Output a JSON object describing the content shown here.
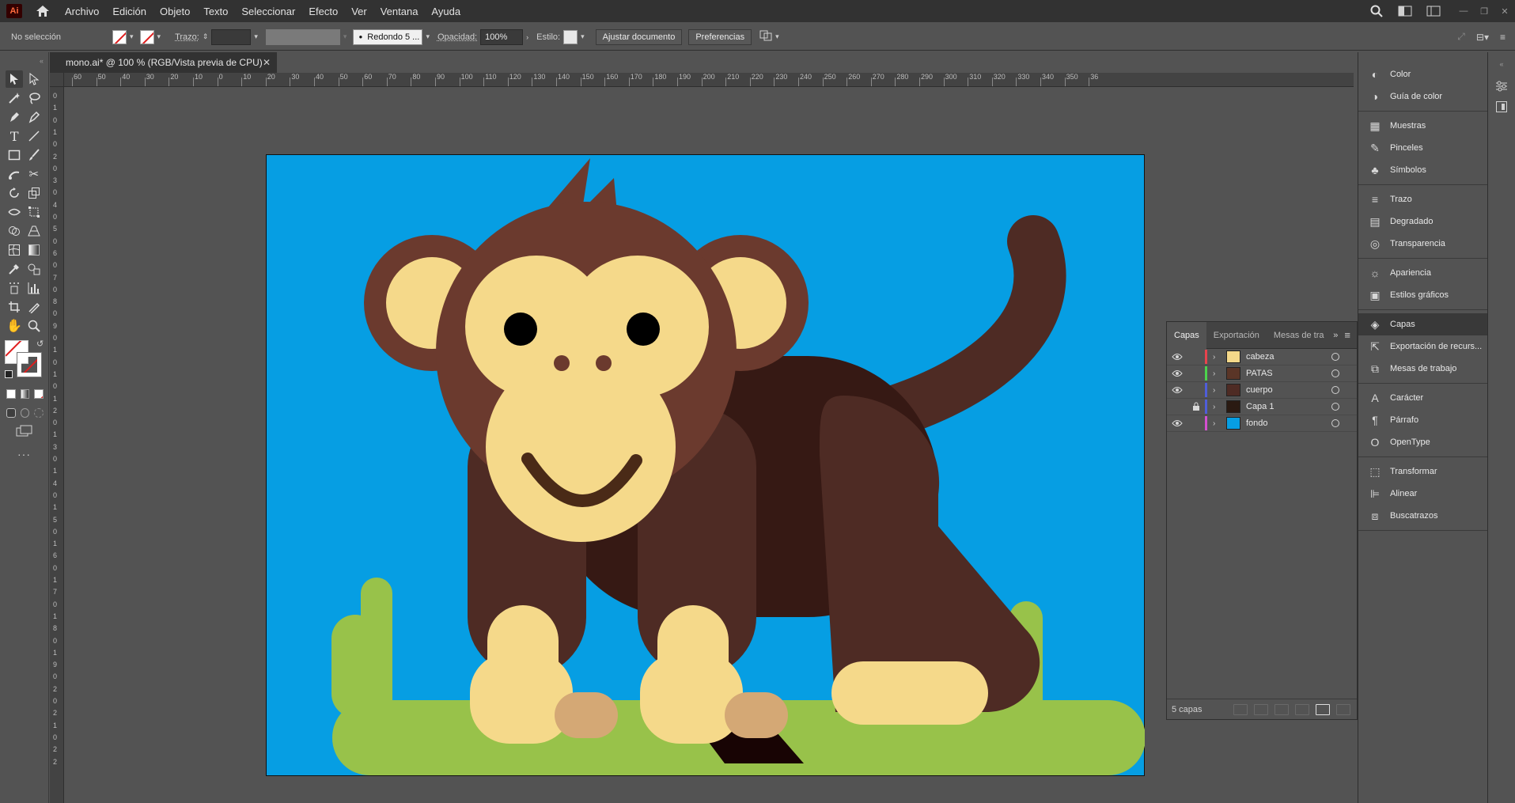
{
  "menubar": {
    "app_logo": "Ai",
    "items": [
      "Archivo",
      "Edición",
      "Objeto",
      "Texto",
      "Seleccionar",
      "Efecto",
      "Ver",
      "Ventana",
      "Ayuda"
    ]
  },
  "controlbar": {
    "selection": "No selección",
    "stroke_label": "Trazo:",
    "brush": "Redondo 5 ...",
    "opacity_label": "Opacidad:",
    "opacity_value": "100%",
    "style_label": "Estilo:",
    "fit_button": "Ajustar documento",
    "prefs_button": "Preferencias"
  },
  "document": {
    "tab_title": "mono.ai* @ 100 % (RGB/Vista previa de CPU)",
    "ruler_h": [
      "60",
      "50",
      "40",
      "30",
      "20",
      "10",
      "0",
      "10",
      "20",
      "30",
      "40",
      "50",
      "60",
      "70",
      "80",
      "90",
      "100",
      "110",
      "120",
      "130",
      "140",
      "150",
      "160",
      "170",
      "180",
      "190",
      "200",
      "210",
      "220",
      "230",
      "240",
      "250",
      "260",
      "270",
      "280",
      "290",
      "300",
      "310",
      "320",
      "330",
      "340",
      "350",
      "36"
    ],
    "ruler_v": [
      "0",
      "1",
      "0",
      "1",
      "0",
      "2",
      "0",
      "3",
      "0",
      "4",
      "0",
      "5",
      "0",
      "6",
      "0",
      "7",
      "0",
      "8",
      "0",
      "9",
      "0",
      "1",
      "0",
      "1",
      "0",
      "1",
      "2",
      "0",
      "1",
      "3",
      "0",
      "1",
      "4",
      "0",
      "1",
      "5",
      "0",
      "1",
      "6",
      "0",
      "1",
      "7",
      "0",
      "1",
      "8",
      "0",
      "1",
      "9",
      "0",
      "2",
      "0",
      "2",
      "1",
      "0",
      "2",
      "2"
    ]
  },
  "layers_panel": {
    "tabs": [
      "Capas",
      "Exportación",
      "Mesas de tra"
    ],
    "layers": [
      {
        "name": "cabeza",
        "color": "#e8434d",
        "thumb": "#f5d98a",
        "visible": true,
        "locked": false
      },
      {
        "name": "PATAS",
        "color": "#4cd34c",
        "thumb": "#5a3527",
        "visible": true,
        "locked": false
      },
      {
        "name": "cuerpo",
        "color": "#4f5ed9",
        "thumb": "#4e2b24",
        "visible": true,
        "locked": false
      },
      {
        "name": "Capa 1",
        "color": "#4f5ed9",
        "thumb": "#2a1a12",
        "visible": false,
        "locked": true
      },
      {
        "name": "fondo",
        "color": "#d44fd0",
        "thumb": "#069ee3",
        "visible": true,
        "locked": false
      }
    ],
    "count": "5 capas"
  },
  "right_dock": {
    "groups": [
      [
        {
          "label": "Color",
          "icon": "color-icon"
        },
        {
          "label": "Guía de color",
          "icon": "color-guide-icon"
        }
      ],
      [
        {
          "label": "Muestras",
          "icon": "swatches-icon"
        },
        {
          "label": "Pinceles",
          "icon": "brushes-icon"
        },
        {
          "label": "Símbolos",
          "icon": "symbols-icon"
        }
      ],
      [
        {
          "label": "Trazo",
          "icon": "stroke-icon"
        },
        {
          "label": "Degradado",
          "icon": "gradient-icon"
        },
        {
          "label": "Transparencia",
          "icon": "transparency-icon"
        }
      ],
      [
        {
          "label": "Apariencia",
          "icon": "appearance-icon"
        },
        {
          "label": "Estilos gráficos",
          "icon": "graphic-styles-icon"
        }
      ],
      [
        {
          "label": "Capas",
          "icon": "layers-icon",
          "active": true
        },
        {
          "label": "Exportación de recurs...",
          "icon": "asset-export-icon"
        },
        {
          "label": "Mesas de trabajo",
          "icon": "artboards-icon"
        }
      ],
      [
        {
          "label": "Carácter",
          "icon": "character-icon"
        },
        {
          "label": "Párrafo",
          "icon": "paragraph-icon"
        },
        {
          "label": "OpenType",
          "icon": "opentype-icon"
        }
      ],
      [
        {
          "label": "Transformar",
          "icon": "transform-icon"
        },
        {
          "label": "Alinear",
          "icon": "align-icon"
        },
        {
          "label": "Buscatrazos",
          "icon": "pathfinder-icon"
        }
      ]
    ]
  },
  "colors": {
    "sky": "#069ee3",
    "grass": "#98c24a",
    "fur_dark": "#4e2b24",
    "fur_mid": "#6b3a2e",
    "face": "#f5d98a",
    "toe": "#d4a875"
  }
}
